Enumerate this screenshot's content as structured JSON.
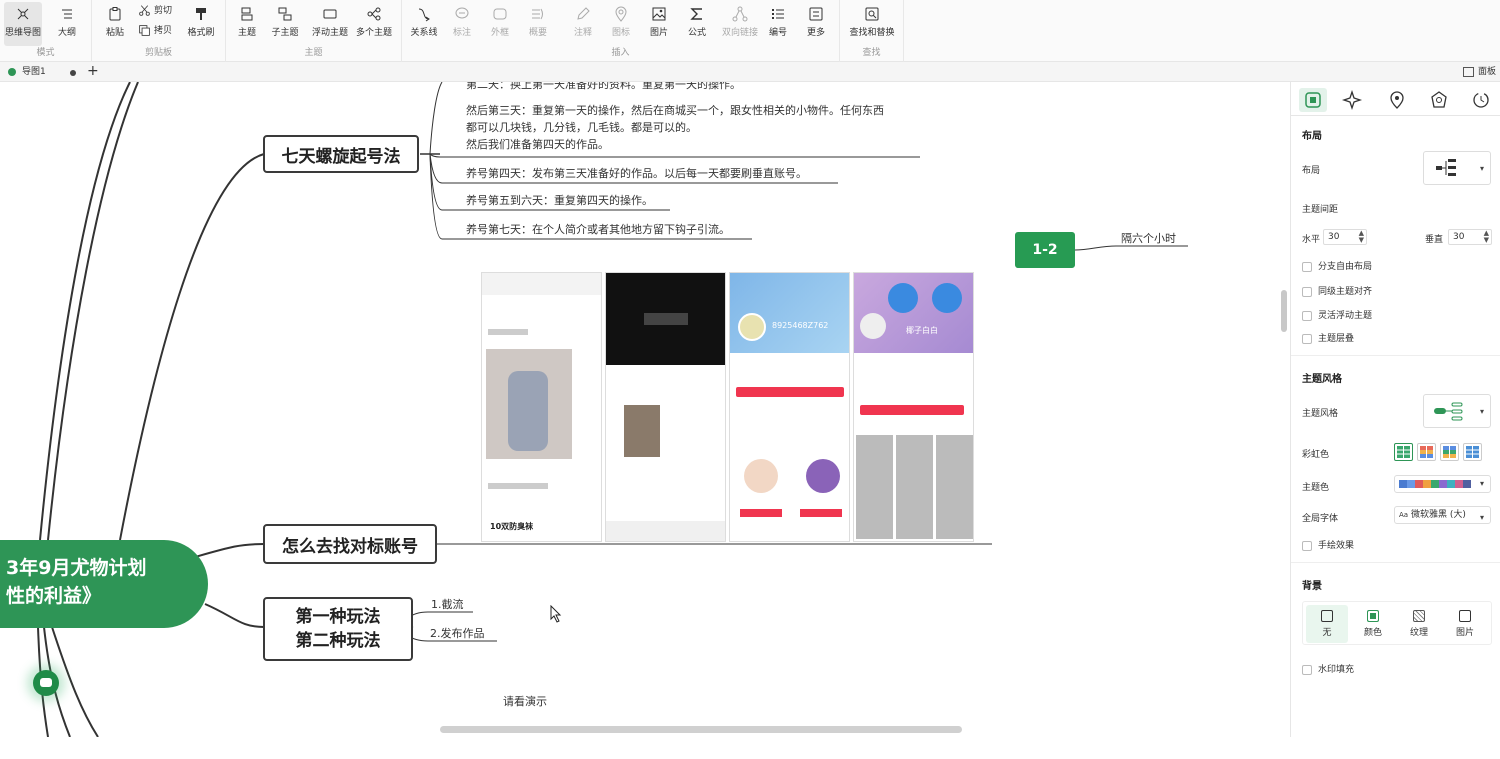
{
  "toolbar": {
    "groups": [
      {
        "label": "模式",
        "items": [
          "思维导图",
          "大纲"
        ]
      },
      {
        "label": "剪贴板",
        "items": [
          "粘贴",
          "剪切",
          "拷贝",
          "格式刷"
        ]
      },
      {
        "label": "主题",
        "items": [
          "主题",
          "子主题",
          "浮动主题",
          "多个主题"
        ]
      },
      {
        "label": "插入",
        "items": [
          "关系线",
          "标注",
          "外框",
          "概要",
          "注释",
          "图标",
          "图片",
          "公式",
          "双向链接",
          "编号",
          "更多"
        ]
      },
      {
        "label": "查找",
        "items": [
          "查找和替换"
        ]
      }
    ]
  },
  "tabs": {
    "doc_tab": "导图1",
    "add": "+",
    "panel_toggle": "面板"
  },
  "mindmap": {
    "central": {
      "line1": "3年9月尤物计划",
      "line2": "性的利益》"
    },
    "topic_seven_days": "七天螺旋起号法",
    "leaves_seven_days": [
      "第二天：换上第一天准备好的资料。重复第一天的操作。",
      "然后第三天：重复第一天的操作，然后在商城买一个，跟女性相关的小物件。任何东西",
      "都可以几块钱，几分钱，几毛钱。都是可以的。",
      "然后我们准备第四天的作品。",
      "养号第四天：发布第三天准备好的作品。以后每一天都要刷垂直账号。",
      "养号第五到六天：重复第四天的操作。",
      "养号第七天：在个人简介或者其他地方留下钩子引流。"
    ],
    "topic_find_accounts": "怎么去找对标账号",
    "topic_play": {
      "line1": "第一种玩法",
      "line2": "第二种玩法"
    },
    "leaves_play": [
      "1.截流",
      "2.发布作品"
    ],
    "topic_12": "1-2",
    "leaf_12": "隔六个小时",
    "demo_caption": "请看演示",
    "phones": [
      {
        "id": "8925468Z762",
        "title": "10双防臭袜"
      },
      {
        "id": "",
        "title": ""
      },
      {
        "id": "8925468Z762",
        "title": ""
      },
      {
        "id": "椰子白白",
        "title": ""
      }
    ]
  },
  "panel": {
    "section_layout": "布局",
    "layout_label": "布局",
    "spacing_label": "主题间距",
    "horizontal_label": "水平",
    "horizontal_value": "30",
    "vertical_label": "垂直",
    "vertical_value": "30",
    "checks_layout": [
      "分支自由布局",
      "同级主题对齐",
      "灵活浮动主题",
      "主题层叠"
    ],
    "section_style": "主题风格",
    "style_label": "主题风格",
    "rainbow_label": "彩虹色",
    "theme_color_label": "主题色",
    "font_label": "全局字体",
    "font_value": "微软雅黑 (大)",
    "hand_drawn": "手绘效果",
    "section_bg": "背景",
    "bg_options": [
      "无",
      "颜色",
      "纹理",
      "图片"
    ],
    "watermark": "水印填充",
    "accent_color": "#2e9556"
  }
}
